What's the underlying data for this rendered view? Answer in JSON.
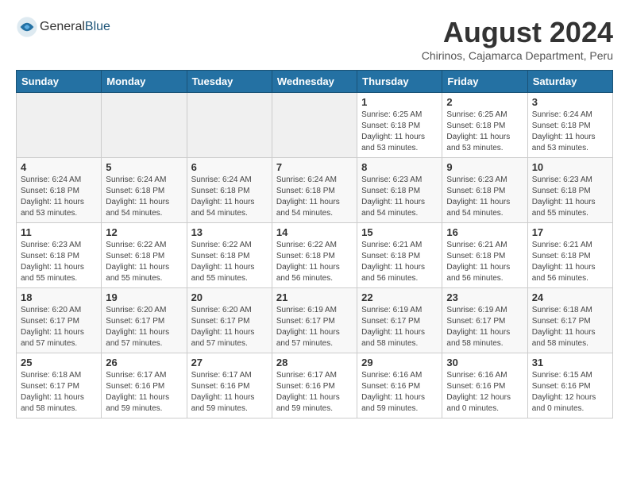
{
  "header": {
    "logo_general": "General",
    "logo_blue": "Blue",
    "month_year": "August 2024",
    "location": "Chirinos, Cajamarca Department, Peru"
  },
  "calendar": {
    "days_of_week": [
      "Sunday",
      "Monday",
      "Tuesday",
      "Wednesday",
      "Thursday",
      "Friday",
      "Saturday"
    ],
    "weeks": [
      [
        {
          "day": "",
          "info": ""
        },
        {
          "day": "",
          "info": ""
        },
        {
          "day": "",
          "info": ""
        },
        {
          "day": "",
          "info": ""
        },
        {
          "day": "1",
          "info": "Sunrise: 6:25 AM\nSunset: 6:18 PM\nDaylight: 11 hours\nand 53 minutes."
        },
        {
          "day": "2",
          "info": "Sunrise: 6:25 AM\nSunset: 6:18 PM\nDaylight: 11 hours\nand 53 minutes."
        },
        {
          "day": "3",
          "info": "Sunrise: 6:24 AM\nSunset: 6:18 PM\nDaylight: 11 hours\nand 53 minutes."
        }
      ],
      [
        {
          "day": "4",
          "info": "Sunrise: 6:24 AM\nSunset: 6:18 PM\nDaylight: 11 hours\nand 53 minutes."
        },
        {
          "day": "5",
          "info": "Sunrise: 6:24 AM\nSunset: 6:18 PM\nDaylight: 11 hours\nand 54 minutes."
        },
        {
          "day": "6",
          "info": "Sunrise: 6:24 AM\nSunset: 6:18 PM\nDaylight: 11 hours\nand 54 minutes."
        },
        {
          "day": "7",
          "info": "Sunrise: 6:24 AM\nSunset: 6:18 PM\nDaylight: 11 hours\nand 54 minutes."
        },
        {
          "day": "8",
          "info": "Sunrise: 6:23 AM\nSunset: 6:18 PM\nDaylight: 11 hours\nand 54 minutes."
        },
        {
          "day": "9",
          "info": "Sunrise: 6:23 AM\nSunset: 6:18 PM\nDaylight: 11 hours\nand 54 minutes."
        },
        {
          "day": "10",
          "info": "Sunrise: 6:23 AM\nSunset: 6:18 PM\nDaylight: 11 hours\nand 55 minutes."
        }
      ],
      [
        {
          "day": "11",
          "info": "Sunrise: 6:23 AM\nSunset: 6:18 PM\nDaylight: 11 hours\nand 55 minutes."
        },
        {
          "day": "12",
          "info": "Sunrise: 6:22 AM\nSunset: 6:18 PM\nDaylight: 11 hours\nand 55 minutes."
        },
        {
          "day": "13",
          "info": "Sunrise: 6:22 AM\nSunset: 6:18 PM\nDaylight: 11 hours\nand 55 minutes."
        },
        {
          "day": "14",
          "info": "Sunrise: 6:22 AM\nSunset: 6:18 PM\nDaylight: 11 hours\nand 56 minutes."
        },
        {
          "day": "15",
          "info": "Sunrise: 6:21 AM\nSunset: 6:18 PM\nDaylight: 11 hours\nand 56 minutes."
        },
        {
          "day": "16",
          "info": "Sunrise: 6:21 AM\nSunset: 6:18 PM\nDaylight: 11 hours\nand 56 minutes."
        },
        {
          "day": "17",
          "info": "Sunrise: 6:21 AM\nSunset: 6:18 PM\nDaylight: 11 hours\nand 56 minutes."
        }
      ],
      [
        {
          "day": "18",
          "info": "Sunrise: 6:20 AM\nSunset: 6:17 PM\nDaylight: 11 hours\nand 57 minutes."
        },
        {
          "day": "19",
          "info": "Sunrise: 6:20 AM\nSunset: 6:17 PM\nDaylight: 11 hours\nand 57 minutes."
        },
        {
          "day": "20",
          "info": "Sunrise: 6:20 AM\nSunset: 6:17 PM\nDaylight: 11 hours\nand 57 minutes."
        },
        {
          "day": "21",
          "info": "Sunrise: 6:19 AM\nSunset: 6:17 PM\nDaylight: 11 hours\nand 57 minutes."
        },
        {
          "day": "22",
          "info": "Sunrise: 6:19 AM\nSunset: 6:17 PM\nDaylight: 11 hours\nand 58 minutes."
        },
        {
          "day": "23",
          "info": "Sunrise: 6:19 AM\nSunset: 6:17 PM\nDaylight: 11 hours\nand 58 minutes."
        },
        {
          "day": "24",
          "info": "Sunrise: 6:18 AM\nSunset: 6:17 PM\nDaylight: 11 hours\nand 58 minutes."
        }
      ],
      [
        {
          "day": "25",
          "info": "Sunrise: 6:18 AM\nSunset: 6:17 PM\nDaylight: 11 hours\nand 58 minutes."
        },
        {
          "day": "26",
          "info": "Sunrise: 6:17 AM\nSunset: 6:16 PM\nDaylight: 11 hours\nand 59 minutes."
        },
        {
          "day": "27",
          "info": "Sunrise: 6:17 AM\nSunset: 6:16 PM\nDaylight: 11 hours\nand 59 minutes."
        },
        {
          "day": "28",
          "info": "Sunrise: 6:17 AM\nSunset: 6:16 PM\nDaylight: 11 hours\nand 59 minutes."
        },
        {
          "day": "29",
          "info": "Sunrise: 6:16 AM\nSunset: 6:16 PM\nDaylight: 11 hours\nand 59 minutes."
        },
        {
          "day": "30",
          "info": "Sunrise: 6:16 AM\nSunset: 6:16 PM\nDaylight: 12 hours\nand 0 minutes."
        },
        {
          "day": "31",
          "info": "Sunrise: 6:15 AM\nSunset: 6:16 PM\nDaylight: 12 hours\nand 0 minutes."
        }
      ]
    ]
  }
}
